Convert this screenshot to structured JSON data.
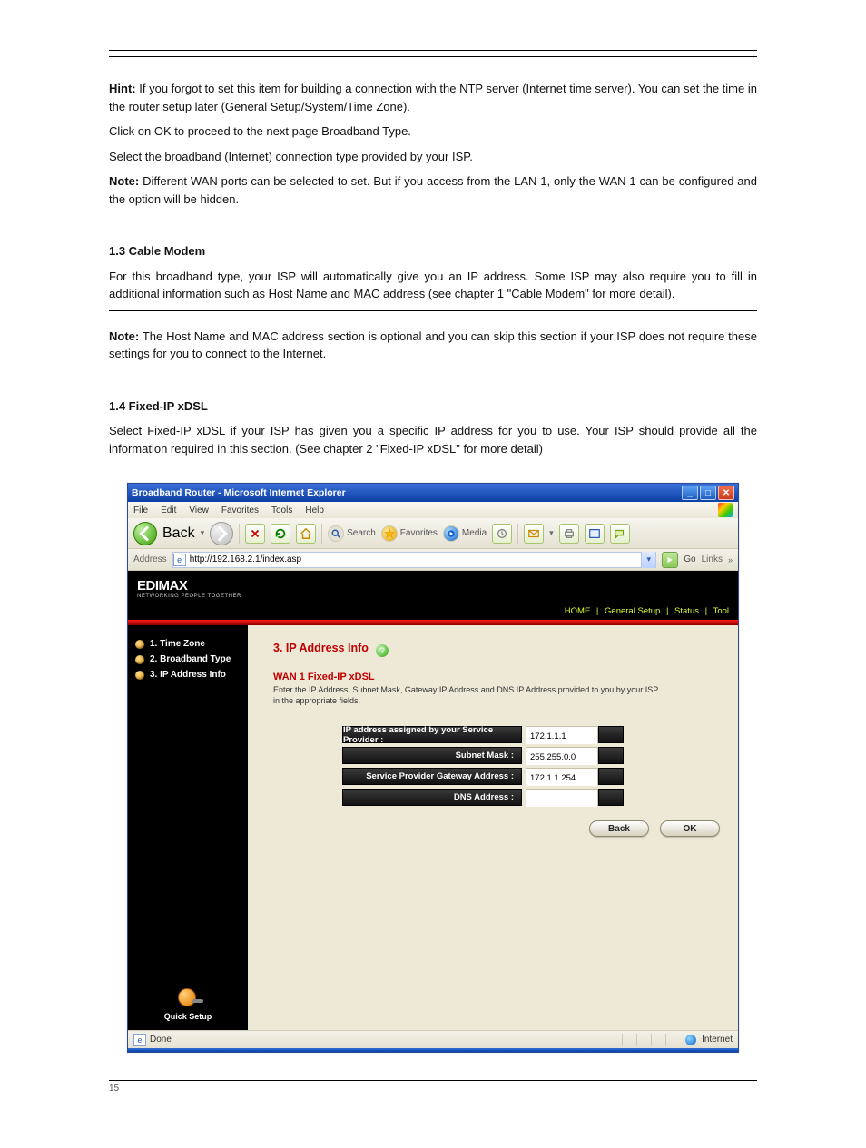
{
  "hint_section": {
    "title_label": "Hint:",
    "title_rest": " If you forgot to set this item for building a connection with the NTP server (Internet time server). You can set the time in the router setup later (General Setup/System/Time Zone).",
    "click_ok": "Click on OK to proceed to the next page Broadband Type.",
    "select_broadband": "Select the broadband (Internet) connection type provided by your ISP.",
    "note_label": "Note:",
    "note_rest": " Different WAN ports can be selected to set. But if you access from the LAN 1, only the WAN 1 can be configured and the option will be hidden."
  },
  "cable_modem": {
    "heading": "1.3 Cable Modem",
    "body": "For this broadband type, your ISP will automatically give you an IP address. Some ISP may also require you to fill in additional information such as Host Name and MAC address (see chapter 1 \"Cable Modem\" for more detail).",
    "note_label": "Note:",
    "note_rest": " The Host Name and MAC address section is optional and you can skip this section if your ISP does not require these settings for you to connect to the Internet."
  },
  "fixed_ip": {
    "heading": "1.4 Fixed-IP xDSL",
    "body": "Select Fixed-IP xDSL if your ISP has given you a specific IP address for you to use. Your ISP should provide all the information required in this section. (See chapter 2 \"Fixed-IP xDSL\" for more detail)"
  },
  "browser": {
    "title": "Broadband Router - Microsoft Internet Explorer",
    "menu": {
      "file": "File",
      "edit": "Edit",
      "view": "View",
      "favorites": "Favorites",
      "tools": "Tools",
      "help": "Help"
    },
    "toolbar": {
      "back": "Back",
      "search": "Search",
      "favorites": "Favorites",
      "media": "Media"
    },
    "addr": {
      "label": "Address",
      "value": "http://192.168.2.1/index.asp",
      "go": "Go",
      "links": "Links"
    },
    "status": {
      "done": "Done",
      "zone": "Internet"
    }
  },
  "router": {
    "brand": "EDIMAX",
    "tagline": "NETWORKING PEOPLE TOGETHER",
    "nav": {
      "home": "HOME",
      "general": "General Setup",
      "status": "Status",
      "tool": "Tool"
    },
    "sidebar": {
      "items": [
        "1. Time Zone",
        "2. Broadband Type",
        "3. IP Address Info"
      ],
      "quick": "Quick Setup"
    },
    "section": {
      "title": "3. IP Address Info",
      "subtitle": "WAN 1 Fixed-IP xDSL",
      "desc": "Enter the IP Address, Subnet Mask, Gateway IP Address and DNS IP Address provided to you by your ISP in the appropriate fields."
    },
    "form": {
      "rows": [
        {
          "label": "IP address assigned by your Service Provider :",
          "value": "172.1.1.1"
        },
        {
          "label": "Subnet Mask :",
          "value": "255.255.0.0"
        },
        {
          "label": "Service Provider Gateway Address :",
          "value": "172.1.1.254"
        },
        {
          "label": "DNS Address :",
          "value": ""
        }
      ],
      "back": "Back",
      "ok": "OK"
    }
  },
  "footer": {
    "page": "15"
  }
}
